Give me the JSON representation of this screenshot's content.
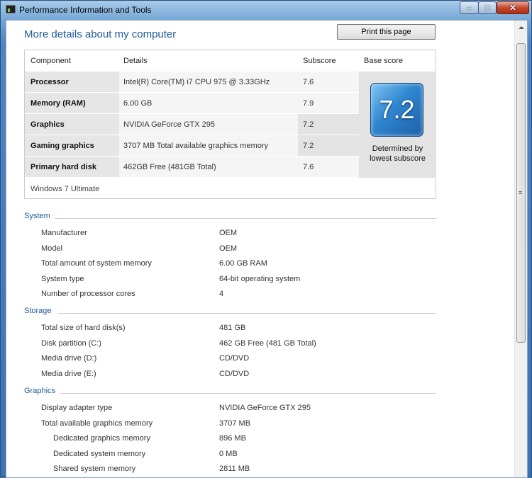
{
  "window": {
    "title": "Performance Information and Tools",
    "minimize_glyph": "–",
    "maximize_glyph": "□",
    "close_glyph": "✕"
  },
  "header": {
    "title": "More details about my computer",
    "print_label": "Print this page"
  },
  "score_table": {
    "headers": [
      "Component",
      "Details",
      "Subscore",
      "Base score"
    ],
    "rows": [
      {
        "component": "Processor",
        "details": "Intel(R) Core(TM) i7 CPU 975 @ 3.33GHz",
        "subscore": "7.6"
      },
      {
        "component": "Memory (RAM)",
        "details": "6.00 GB",
        "subscore": "7.9"
      },
      {
        "component": "Graphics",
        "details": "NVIDIA GeForce GTX 295",
        "subscore": "7.2"
      },
      {
        "component": "Gaming graphics",
        "details": "3707 MB Total available graphics memory",
        "subscore": "7.2"
      },
      {
        "component": "Primary hard disk",
        "details": "462GB Free (481GB Total)",
        "subscore": "7.6"
      }
    ],
    "base_score": "7.2",
    "determined_line1": "Determined by",
    "determined_line2": "lowest subscore",
    "edition": "Windows 7 Ultimate"
  },
  "system": {
    "title": "System",
    "items": [
      {
        "label": "Manufacturer",
        "value": "OEM"
      },
      {
        "label": "Model",
        "value": "OEM"
      },
      {
        "label": "Total amount of system memory",
        "value": "6.00 GB RAM"
      },
      {
        "label": "System type",
        "value": "64-bit operating system"
      },
      {
        "label": "Number of processor cores",
        "value": "4"
      }
    ]
  },
  "storage": {
    "title": "Storage",
    "items": [
      {
        "label": "Total size of hard disk(s)",
        "value": "481 GB"
      },
      {
        "label": "Disk partition (C:)",
        "value": "462 GB Free (481 GB Total)"
      },
      {
        "label": "Media drive (D:)",
        "value": "CD/DVD"
      },
      {
        "label": "Media drive (E:)",
        "value": "CD/DVD"
      }
    ]
  },
  "graphics": {
    "title": "Graphics",
    "items": [
      {
        "label": "Display adapter type",
        "value": "NVIDIA GeForce GTX 295"
      },
      {
        "label": "Total available graphics memory",
        "value": "3707 MB"
      },
      {
        "label": "Dedicated graphics memory",
        "value": "896 MB"
      },
      {
        "label": "Dedicated system memory",
        "value": "0 MB"
      },
      {
        "label": "Shared system memory",
        "value": "2811 MB"
      }
    ]
  },
  "scrollbar": {
    "grip_glyph": "≡"
  }
}
